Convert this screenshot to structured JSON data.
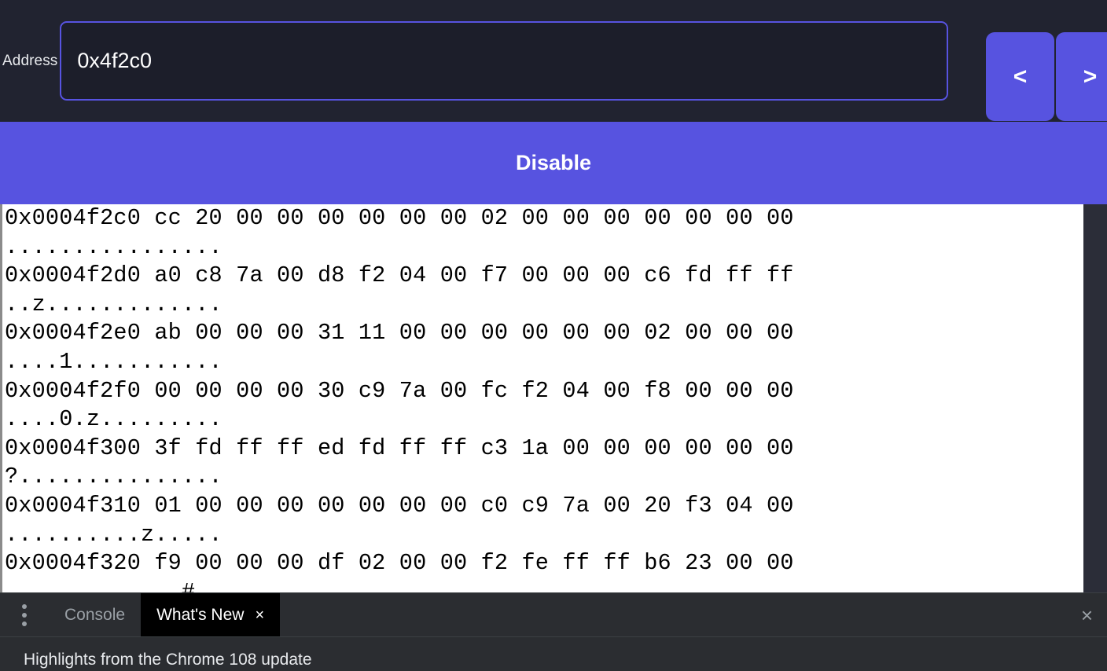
{
  "toolbar": {
    "address_label": "Address",
    "address_value": "0x4f2c0",
    "address_placeholder": "Address",
    "prev_label": "<",
    "next_label": ">",
    "disable_label": "Disable",
    "accent_color": "#5753e0",
    "background_color": "#212330"
  },
  "memory_view": {
    "rows": [
      {
        "offset": "0x0004f2c0",
        "bytes": "cc 20 00 00 00 00 00 00 02 00 00 00 00 00 00 00",
        "ascii": "................"
      },
      {
        "offset": "0x0004f2d0",
        "bytes": "a0 c8 7a 00 d8 f2 04 00 f7 00 00 00 c6 fd ff ff",
        "ascii": "..z............."
      },
      {
        "offset": "0x0004f2e0",
        "bytes": "ab 00 00 00 31 11 00 00 00 00 00 00 02 00 00 00",
        "ascii": "....1..........."
      },
      {
        "offset": "0x0004f2f0",
        "bytes": "00 00 00 00 30 c9 7a 00 fc f2 04 00 f8 00 00 00",
        "ascii": "....0.z........."
      },
      {
        "offset": "0x0004f300",
        "bytes": "3f fd ff ff ed fd ff ff c3 1a 00 00 00 00 00 00",
        "ascii": "?..............."
      },
      {
        "offset": "0x0004f310",
        "bytes": "01 00 00 00 00 00 00 00 c0 c9 7a 00 20 f3 04 00",
        "ascii": "..........z....."
      },
      {
        "offset": "0x0004f320",
        "bytes": "f9 00 00 00 df 02 00 00 f2 fe ff ff b6 23 00 00",
        "ascii": ".............#.."
      }
    ]
  },
  "drawer": {
    "menu_icon": "three-dots-icon",
    "tabs": [
      {
        "label": "Console",
        "active": false,
        "closable": false
      },
      {
        "label": "What's New",
        "active": true,
        "closable": true
      }
    ],
    "tab_close_label": "×",
    "drawer_close_label": "×",
    "content_headline": "Highlights from the Chrome 108 update"
  }
}
